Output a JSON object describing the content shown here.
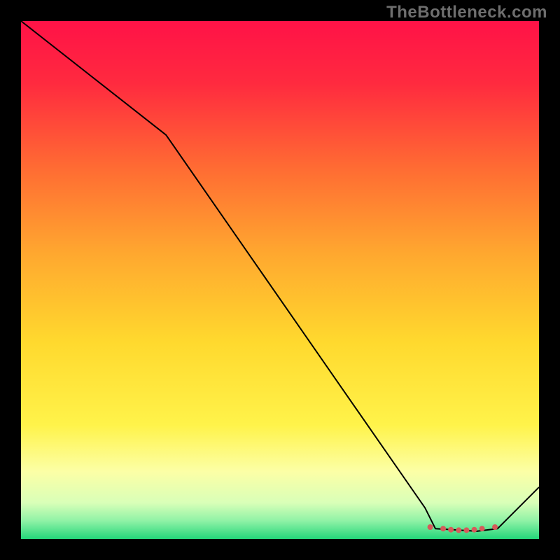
{
  "watermark": "TheBottleneck.com",
  "chart_data": {
    "type": "line",
    "title": "",
    "xlabel": "",
    "ylabel": "",
    "xlim": [
      0,
      100
    ],
    "ylim": [
      0,
      100
    ],
    "grid": false,
    "series": [
      {
        "name": "curve",
        "x": [
          0,
          28,
          78,
          80,
          88,
          92,
          100
        ],
        "y": [
          100,
          78,
          6,
          2,
          1.5,
          2,
          10
        ],
        "stroke": "#000000",
        "width": 2
      }
    ],
    "markers": {
      "name": "dots",
      "x": [
        79,
        81.5,
        83,
        84.5,
        86,
        87.5,
        89,
        91.5
      ],
      "y": [
        2.3,
        2.0,
        1.8,
        1.7,
        1.7,
        1.8,
        2.0,
        2.3
      ],
      "r": 4,
      "fill": "#d65a5a"
    },
    "background_gradient": {
      "stops": [
        {
          "offset": 0.0,
          "color": "#ff1247"
        },
        {
          "offset": 0.12,
          "color": "#ff2a3f"
        },
        {
          "offset": 0.28,
          "color": "#ff6a33"
        },
        {
          "offset": 0.45,
          "color": "#ffa82f"
        },
        {
          "offset": 0.62,
          "color": "#ffd92e"
        },
        {
          "offset": 0.78,
          "color": "#fff34a"
        },
        {
          "offset": 0.87,
          "color": "#fcffa6"
        },
        {
          "offset": 0.93,
          "color": "#d9ffb8"
        },
        {
          "offset": 0.965,
          "color": "#8ff2a6"
        },
        {
          "offset": 1.0,
          "color": "#24d67a"
        }
      ]
    }
  }
}
